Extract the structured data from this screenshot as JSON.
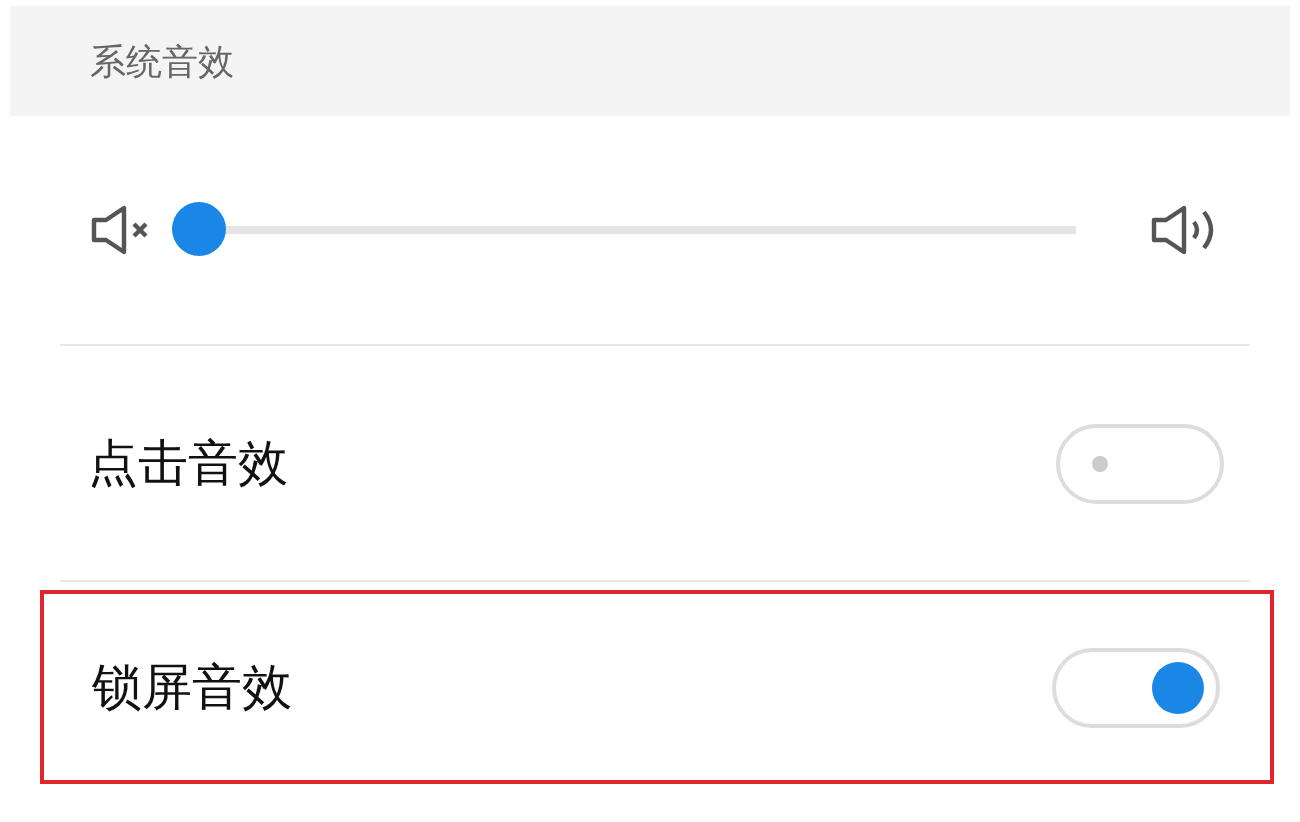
{
  "section_header": "系统音效",
  "volume": {
    "level": 0
  },
  "settings": [
    {
      "label": "点击音效",
      "on": false,
      "highlighted": false
    },
    {
      "label": "锁屏音效",
      "on": true,
      "highlighted": true
    }
  ]
}
